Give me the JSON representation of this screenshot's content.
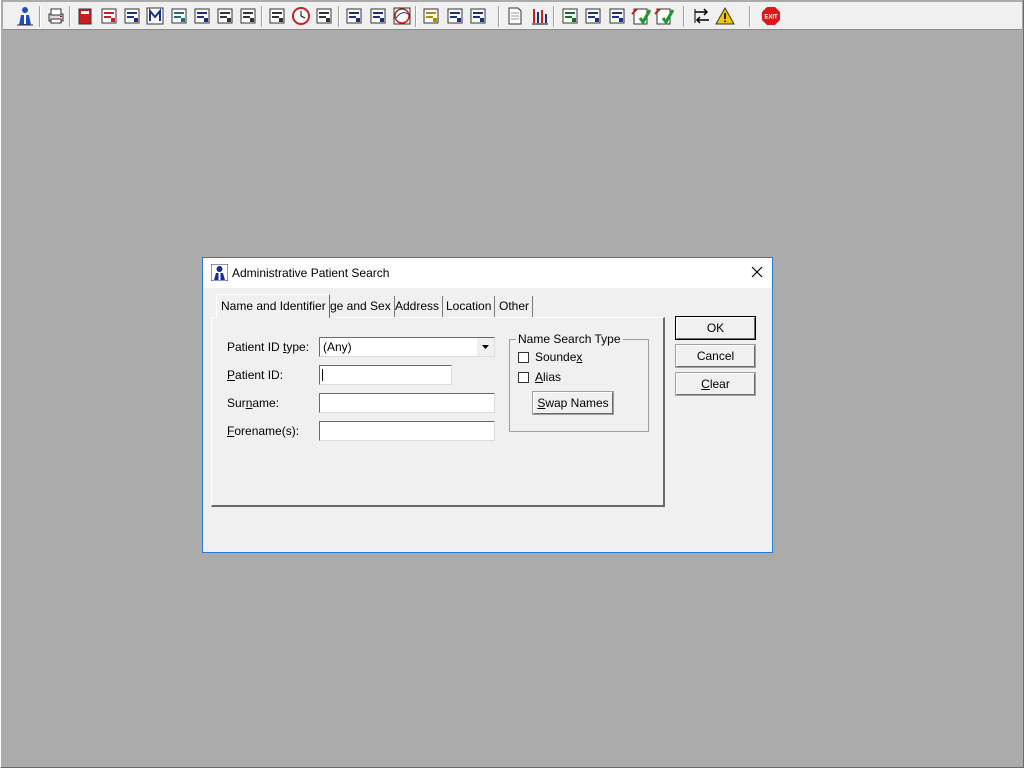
{
  "toolbar": {
    "icons": [
      {
        "name": "patient-icon",
        "color": "#1f4fb8"
      },
      {
        "name": "print-icon",
        "color": "#6b6b6b"
      },
      {
        "name": "book-icon",
        "color": "#c8201e"
      },
      {
        "name": "edit-note-icon",
        "color": "#c8201e"
      },
      {
        "name": "worklist-icon",
        "color": "#1a2f8a"
      },
      {
        "name": "letter-m-icon",
        "color": "#1a2f8a"
      },
      {
        "name": "clinician-icon",
        "color": "#1c6f7a"
      },
      {
        "name": "form-icon",
        "color": "#1a2f8a"
      },
      {
        "name": "flag-icon",
        "color": "#333333"
      },
      {
        "name": "flag-alt-icon",
        "color": "#333333"
      },
      {
        "name": "mail-icon",
        "color": "#333333"
      },
      {
        "name": "clock-icon",
        "color": "#c8201e"
      },
      {
        "name": "monitor-icon",
        "color": "#333333"
      },
      {
        "name": "chart-icon",
        "color": "#1a2f8a"
      },
      {
        "name": "report-icon",
        "color": "#1a2f8a"
      },
      {
        "name": "globe-icon",
        "color": "#c8201e"
      },
      {
        "name": "notes-icon",
        "color": "#b38b00"
      },
      {
        "name": "bed-icon",
        "color": "#1a2f8a"
      },
      {
        "name": "scan-icon",
        "color": "#1a2f8a"
      },
      {
        "name": "document-icon",
        "color": "#555555"
      },
      {
        "name": "bar-chart-icon",
        "color": "#c8201e"
      },
      {
        "name": "network-icon",
        "color": "#1a6b2a"
      },
      {
        "name": "checklist-icon",
        "color": "#1a2f8a"
      },
      {
        "name": "review-icon",
        "color": "#1a2f8a"
      },
      {
        "name": "approve-icon",
        "color": "#1a9a2a"
      },
      {
        "name": "approve-alt-icon",
        "color": "#1a9a2a"
      },
      {
        "name": "swap-icon",
        "color": "#333333"
      },
      {
        "name": "warning-icon",
        "color": "#f2c500"
      },
      {
        "name": "exit-icon",
        "color": "#d91818"
      }
    ],
    "exit_label": "EXIT"
  },
  "dialog": {
    "title": "Administrative Patient Search",
    "tabs": [
      {
        "label": "Name and Identifier",
        "active": true
      },
      {
        "label": "Age and Sex",
        "active": false
      },
      {
        "label": "Address",
        "active": false
      },
      {
        "label": "Location",
        "active": false
      },
      {
        "label": "Other",
        "active": false
      }
    ],
    "fields": {
      "id_type_label_pre": "Patient ID ",
      "id_type_label_u": "t",
      "id_type_label_post": "ype:",
      "id_type_value": "(Any)",
      "patient_id_label_u": "P",
      "patient_id_label_post": "atient ID:",
      "patient_id_value": "",
      "surname_label_pre": "Sur",
      "surname_label_u": "n",
      "surname_label_post": "ame:",
      "surname_value": "",
      "forename_label_u": "F",
      "forename_label_post": "orename(s):",
      "forename_value": ""
    },
    "name_search": {
      "title": "Name Search Type",
      "soundex_pre": "Sounde",
      "soundex_u": "x",
      "soundex_checked": false,
      "alias_u": "A",
      "alias_post": "lias",
      "alias_checked": false,
      "swap_u": "S",
      "swap_post": "wap Names"
    },
    "buttons": {
      "ok": "OK",
      "cancel": "Cancel",
      "clear_u": "C",
      "clear_post": "lear"
    }
  }
}
